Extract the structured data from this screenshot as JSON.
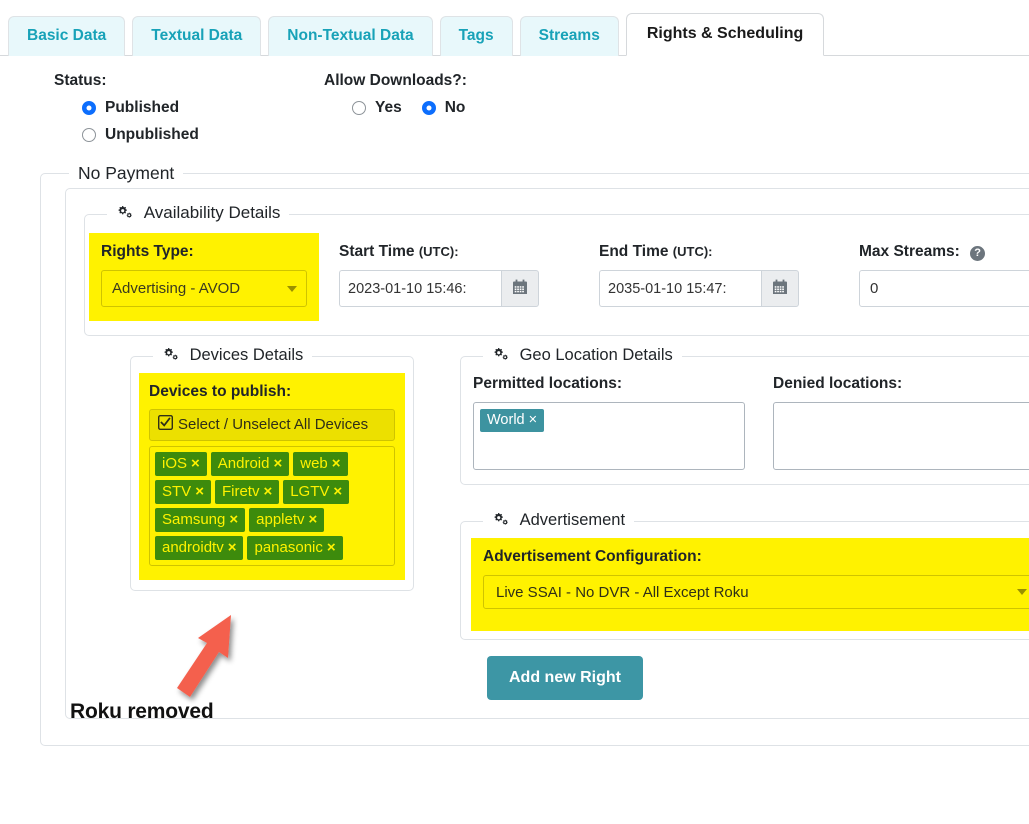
{
  "tabs": [
    {
      "label": "Basic Data",
      "active": false
    },
    {
      "label": "Textual Data",
      "active": false
    },
    {
      "label": "Non-Textual Data",
      "active": false
    },
    {
      "label": "Tags",
      "active": false
    },
    {
      "label": "Streams",
      "active": false
    },
    {
      "label": "Rights & Scheduling",
      "active": true
    }
  ],
  "status": {
    "label": "Status:",
    "options": [
      {
        "label": "Published",
        "checked": true
      },
      {
        "label": "Unpublished",
        "checked": false
      }
    ]
  },
  "downloads": {
    "label": "Allow Downloads?:",
    "options": [
      {
        "label": "Yes",
        "checked": false
      },
      {
        "label": "No",
        "checked": true
      }
    ]
  },
  "payment_section": {
    "legend": "No Payment"
  },
  "availability": {
    "legend": "Availability Details",
    "rights_type": {
      "label": "Rights Type:",
      "value": "Advertising - AVOD"
    },
    "start_time": {
      "label": "Start Time",
      "unit": "(UTC):",
      "value": "2023-01-10 15:46:",
      "calendar_icon": "calendar-icon"
    },
    "end_time": {
      "label": "End Time",
      "unit": "(UTC):",
      "value": "2035-01-10 15:47:",
      "calendar_icon": "calendar-icon"
    },
    "max_streams": {
      "label": "Max Streams:",
      "value": "0",
      "help_icon": "help-circle-icon"
    }
  },
  "devices": {
    "legend": "Devices Details",
    "label": "Devices to publish:",
    "select_all_label": "Select / Unselect All Devices",
    "tags": [
      "iOS",
      "Android",
      "web",
      "STV",
      "Firetv",
      "LGTV",
      "Samsung",
      "appletv",
      "androidtv",
      "panasonic"
    ]
  },
  "geo": {
    "legend": "Geo Location Details",
    "permitted": {
      "label": "Permitted locations:",
      "tokens": [
        "World"
      ]
    },
    "denied": {
      "label": "Denied locations:",
      "tokens": []
    }
  },
  "advertisement": {
    "legend": "Advertisement",
    "config_label": "Advertisement Configuration:",
    "config_value": "Live SSAI - No DVR - All Except Roku"
  },
  "annotation": {
    "text": "Roku removed",
    "arrow_color": "#F4604E"
  },
  "footer": {
    "add_right_label": "Add new Right"
  },
  "colors": {
    "highlight": "#FFF200",
    "tag_green": "#3D8B0C",
    "tag_text": "#FFF200",
    "token_teal": "#3D93A0",
    "tab_text": "#18A2B8",
    "tab_bg": "#E8F8FB",
    "radio_blue": "#0D6EFD",
    "button_teal": "#3D96A5"
  }
}
